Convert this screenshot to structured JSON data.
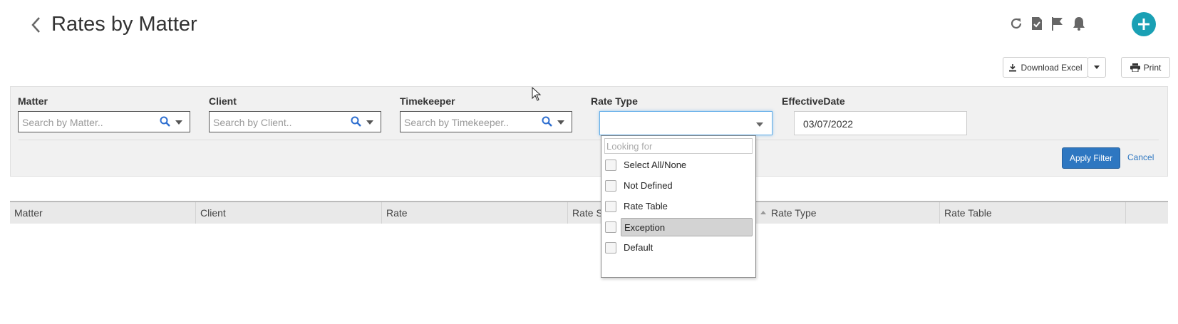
{
  "header": {
    "title": "Rates by Matter",
    "icons": [
      "back-icon",
      "refresh-icon",
      "tasks-icon",
      "flag-icon",
      "bell-icon",
      "add-icon"
    ]
  },
  "toolbar": {
    "download_label": "Download Excel",
    "print_label": "Print"
  },
  "filters": {
    "matter": {
      "label": "Matter",
      "placeholder": "Search by Matter.."
    },
    "client": {
      "label": "Client",
      "placeholder": "Search by Client.."
    },
    "timekeeper": {
      "label": "Timekeeper",
      "placeholder": "Search by Timekeeper.."
    },
    "rate_type": {
      "label": "Rate Type",
      "value": ""
    },
    "effective_date": {
      "label": "EffectiveDate",
      "value": "03/07/2022"
    },
    "apply_label": "Apply Filter",
    "cancel_label": "Cancel"
  },
  "dropdown": {
    "search_placeholder": "Looking for",
    "options": [
      {
        "label": "Select All/None",
        "checked": false
      },
      {
        "label": "Not Defined",
        "checked": false
      },
      {
        "label": "Rate Table",
        "checked": false
      },
      {
        "label": "Exception",
        "checked": false,
        "highlighted": true
      },
      {
        "label": "Default",
        "checked": false
      }
    ]
  },
  "table": {
    "columns": [
      "Matter",
      "Client",
      "Rate",
      "Rate S",
      "Rate Type",
      "Rate Table",
      ""
    ]
  },
  "colors": {
    "accent": "#1aa0b4",
    "primary_button": "#2e77c1"
  }
}
